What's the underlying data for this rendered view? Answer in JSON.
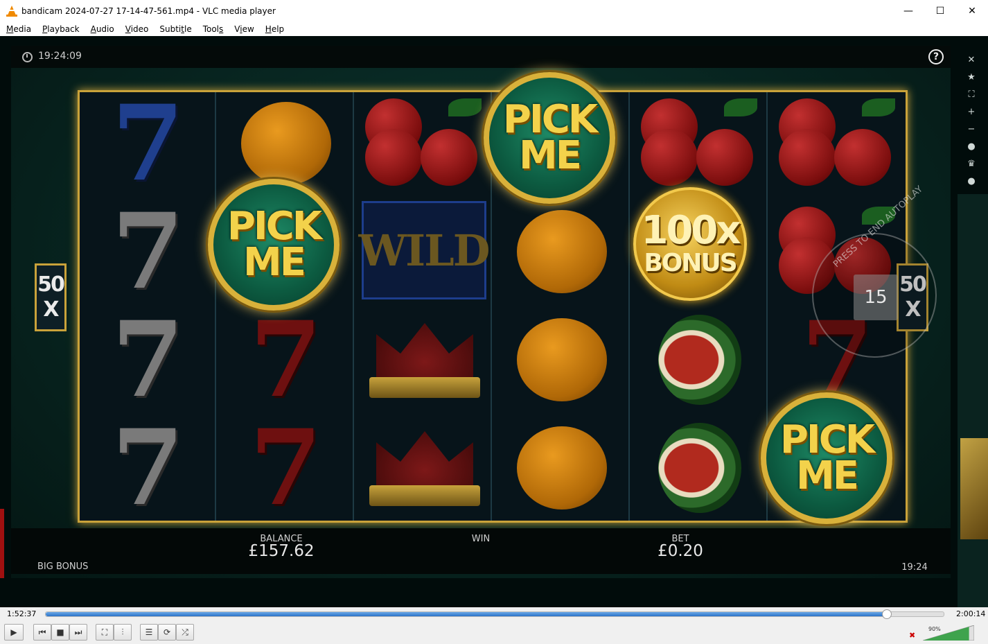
{
  "window": {
    "title": "bandicam 2024-07-27 17-14-47-561.mp4 - VLC media player",
    "minimize": "—",
    "maximize": "☐",
    "close": "✕"
  },
  "menu": [
    {
      "u": "M",
      "rest": "edia"
    },
    {
      "u": "P",
      "rest": "layback"
    },
    {
      "u": "A",
      "rest": "udio"
    },
    {
      "u": "V",
      "rest": "ideo"
    },
    {
      "u": "",
      "pre": "Subti",
      "uMid": "t",
      "rest": "le"
    },
    {
      "u": "",
      "pre": "Tool",
      "uMid": "s",
      "rest": ""
    },
    {
      "u": "",
      "pre": "V",
      "uMid": "i",
      "rest": "ew"
    },
    {
      "u": "H",
      "rest": "elp"
    }
  ],
  "game": {
    "clock": "19:24:09",
    "help": "?",
    "side_icons": [
      "close-icon",
      "star-icon",
      "fullscreen-icon",
      "plus-icon",
      "minus-icon",
      "chip-icon",
      "trophy-icon",
      "chat-icon"
    ],
    "side_glyphs": [
      "✕",
      "★",
      "⛶",
      "+",
      "−",
      "●",
      "♛",
      "●"
    ],
    "pick_line1": "PICK",
    "pick_line2": "ME",
    "wild": "WILD",
    "bonus_top": "100x",
    "bonus_bottom": "BONUS",
    "multiplier_top": "50",
    "multiplier_bottom": "X",
    "autoplay_text": "PRESS TO END AUTOPLAY",
    "autoplay_count": "15",
    "balance_label": "BALANCE",
    "balance_value": "£157.62",
    "win_label": "WIN",
    "bet_label": "BET",
    "bet_value": "£0.20",
    "game_name": "BIG BONUS",
    "bottom_time": "19:24"
  },
  "player": {
    "elapsed": "1:52:37",
    "total": "2:00:14",
    "progress_fraction": 0.9364,
    "volume": "90%",
    "buttons": [
      "play-icon",
      "prev-icon",
      "stop-icon",
      "next-icon",
      "fullscreen-icon",
      "extended-settings-icon",
      "playlist-icon",
      "loop-icon",
      "shuffle-icon"
    ],
    "glyphs": [
      "▶",
      "⏮",
      "■",
      "⏭",
      "⛶",
      "⫶",
      "☰",
      "⟳",
      "⤮"
    ]
  }
}
